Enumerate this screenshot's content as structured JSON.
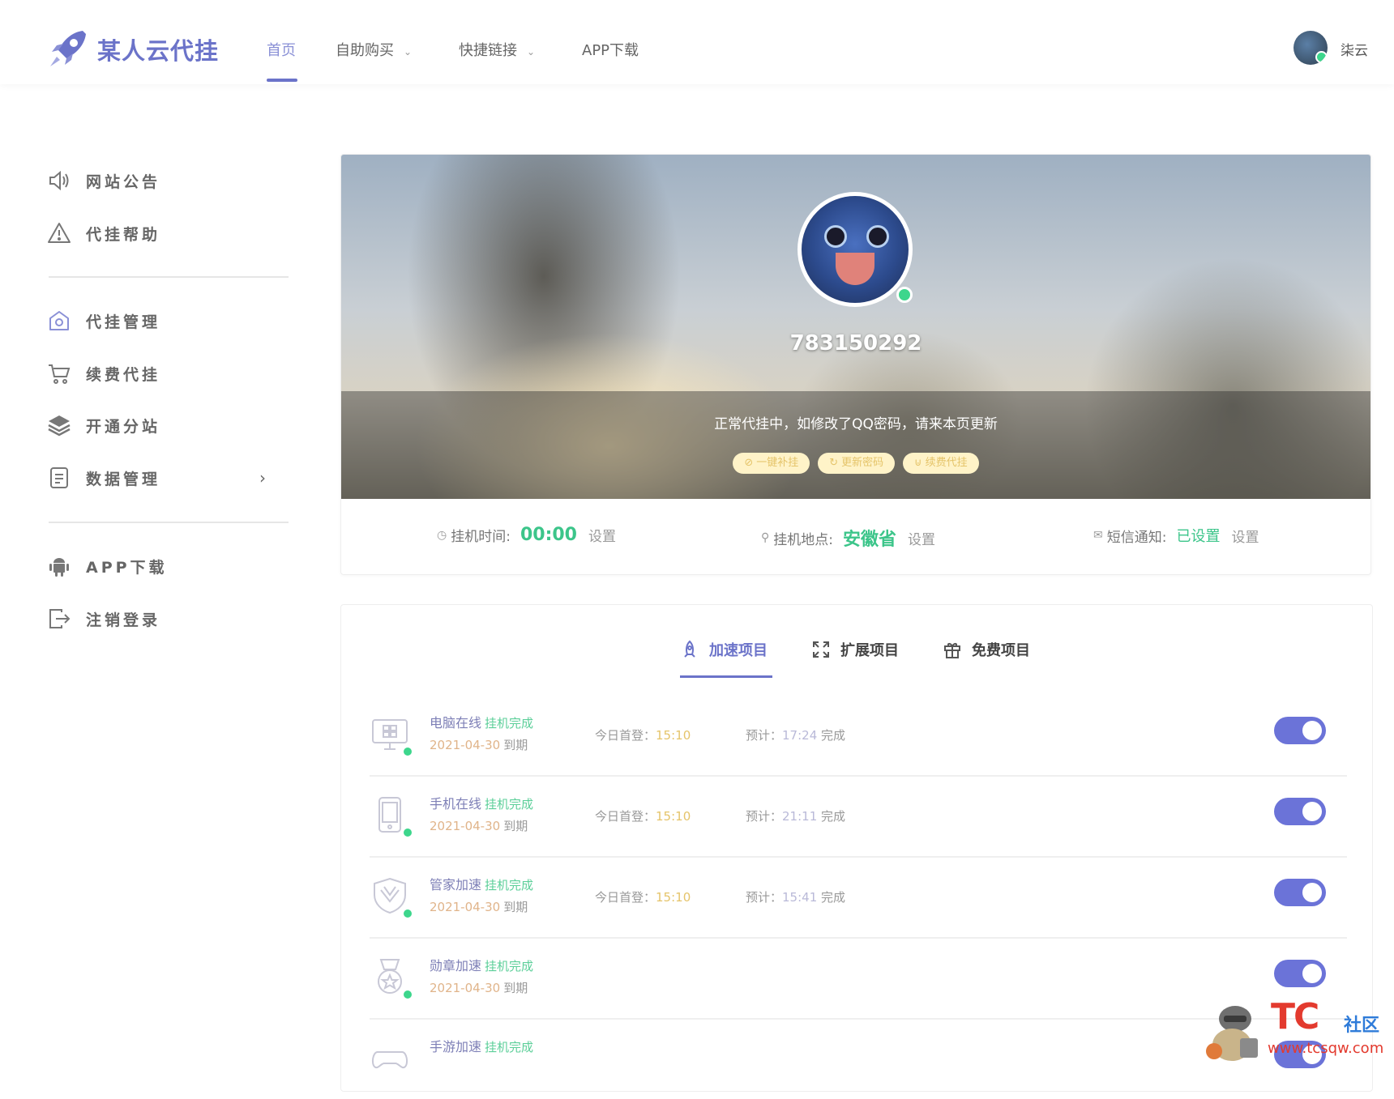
{
  "header": {
    "brand": "某人云代挂",
    "nav": [
      {
        "label": "首页",
        "active": true
      },
      {
        "label": "自助购买",
        "has_dropdown": true
      },
      {
        "label": "快捷链接",
        "has_dropdown": true
      },
      {
        "label": "APP下载"
      }
    ],
    "user_name": "柒云"
  },
  "sidebar": {
    "group1": [
      {
        "label": "网站公告",
        "icon": "speaker-icon"
      },
      {
        "label": "代挂帮助",
        "icon": "warning-icon"
      }
    ],
    "group2": [
      {
        "label": "代挂管理",
        "icon": "home-icon"
      },
      {
        "label": "续费代挂",
        "icon": "cart-icon"
      },
      {
        "label": "开通分站",
        "icon": "layers-icon"
      },
      {
        "label": "数据管理",
        "icon": "document-icon",
        "arrow": "›"
      }
    ],
    "group3": [
      {
        "label": "APP下载",
        "icon": "android-icon"
      },
      {
        "label": "注销登录",
        "icon": "logout-icon"
      }
    ]
  },
  "profile": {
    "qq": "783150292",
    "notice": "正常代挂中，如修改了QQ密码，请来本页更新",
    "buttons": [
      "一键补挂",
      "更新密码",
      "续费代挂"
    ],
    "stats": [
      {
        "label": "挂机时间:",
        "value": "00:00",
        "action": "设置",
        "icon": "clock-icon"
      },
      {
        "label": "挂机地点:",
        "value": "安徽省",
        "action": "设置",
        "icon": "location-icon"
      },
      {
        "label": "短信通知:",
        "value": "已设置",
        "action": "设置",
        "icon": "message-icon"
      }
    ]
  },
  "projects": {
    "tabs": [
      {
        "label": "加速项目",
        "icon": "rocket-icon",
        "active": true
      },
      {
        "label": "扩展项目",
        "icon": "expand-icon"
      },
      {
        "label": "免费项目",
        "icon": "gift-icon"
      }
    ],
    "rows": [
      {
        "name": "电脑在线",
        "status": "挂机完成",
        "date": "2021-04-30",
        "expire": "到期",
        "login_label": "今日首登：",
        "login_time": "15:10",
        "eta_label": "预计：",
        "eta_time": "17:24",
        "eta_suffix": "完成",
        "icon": "computer-icon",
        "enabled": true
      },
      {
        "name": "手机在线",
        "status": "挂机完成",
        "date": "2021-04-30",
        "expire": "到期",
        "login_label": "今日首登：",
        "login_time": "15:10",
        "eta_label": "预计：",
        "eta_time": "21:11",
        "eta_suffix": "完成",
        "icon": "phone-icon",
        "enabled": true
      },
      {
        "name": "管家加速",
        "status": "挂机完成",
        "date": "2021-04-30",
        "expire": "到期",
        "login_label": "今日首登：",
        "login_time": "15:10",
        "eta_label": "预计：",
        "eta_time": "15:41",
        "eta_suffix": "完成",
        "icon": "shield-icon",
        "enabled": true
      },
      {
        "name": "勋章加速",
        "status": "挂机完成",
        "date": "2021-04-30",
        "expire": "到期",
        "icon": "medal-icon",
        "enabled": true
      },
      {
        "name": "手游加速",
        "status": "挂机完成",
        "icon": "gamepad-icon",
        "enabled": true
      }
    ]
  },
  "watermark": {
    "brand": "TC",
    "suffix": "社区",
    "url": "www.tcsqw.com"
  },
  "colors": {
    "accent": "#6b73c9",
    "success": "#3cc58a",
    "toggle": "#6b73d8",
    "pill_bg": "#fff3c8"
  }
}
